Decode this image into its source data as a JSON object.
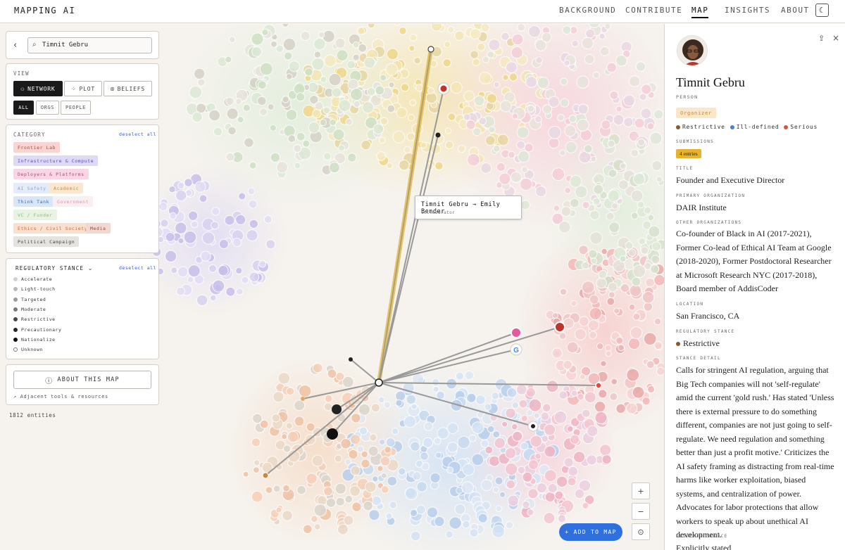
{
  "brand": "MAPPING AI",
  "nav": [
    "BACKGROUND",
    "CONTRIBUTE",
    "MAP",
    "INSIGHTS",
    "ABOUT"
  ],
  "nav_active": "MAP",
  "theme_icon": "☾",
  "search": {
    "value": "Timnit Gebru",
    "icon": "search-icon"
  },
  "view": {
    "label": "VIEW",
    "modes": [
      "NETWORK",
      "PLOT",
      "BELIEFS"
    ],
    "active_mode": "NETWORK",
    "filters": [
      "ALL",
      "ORGS",
      "PEOPLE"
    ],
    "active_filter": "ALL"
  },
  "category": {
    "label": "CATEGORY",
    "deselect": "deselect all",
    "items": [
      {
        "label": "Frontier Lab",
        "bg": "#fbd3d0",
        "fg": "#b2463c"
      },
      {
        "label": "Infrastructure & Compute",
        "bg": "#ded9f5",
        "fg": "#5a4cb0"
      },
      {
        "label": "Deployers & Platforms",
        "bg": "#f9d6e6",
        "fg": "#b3447a"
      },
      {
        "label": "AI Safety",
        "bg": "#e4ecfa",
        "fg": "#8aa4d8"
      },
      {
        "label": "Academic",
        "bg": "#fbe7cf",
        "fg": "#c98a3c"
      },
      {
        "label": "Think Tank",
        "bg": "#d8e6f7",
        "fg": "#3e6aa8"
      },
      {
        "label": "Government",
        "bg": "#fbeef0",
        "fg": "#d49ba8"
      },
      {
        "label": "VC / Funder",
        "bg": "#e8f3e3",
        "fg": "#8fb97e"
      },
      {
        "label": "Ethics / Civil Society",
        "bg": "#fbe0cf",
        "fg": "#c0693b"
      },
      {
        "label": "Media",
        "bg": "#f3d8d0",
        "fg": "#8a4b3b"
      },
      {
        "label": "Political Campaign",
        "bg": "#e4e3e0",
        "fg": "#444444"
      }
    ]
  },
  "stance": {
    "label": "REGULATORY STANCE",
    "deselect": "deselect all",
    "items": [
      {
        "label": "Accelerate",
        "color": "#d4d1cc"
      },
      {
        "label": "Light-touch",
        "color": "#bdb9b2"
      },
      {
        "label": "Targeted",
        "color": "#9e9a93"
      },
      {
        "label": "Moderate",
        "color": "#7c7871"
      },
      {
        "label": "Restrictive",
        "color": "#4a4640"
      },
      {
        "label": "Precautionary",
        "color": "#2a2724"
      },
      {
        "label": "Nationalize",
        "color": "#111111"
      },
      {
        "label": "Unknown",
        "color": "#ffffff"
      }
    ]
  },
  "about": {
    "button": "ABOUT THIS MAP",
    "adjacent": "↗ Adjacent tools & resources"
  },
  "entity_count": "1812 entities",
  "tooltip": {
    "title": "Timnit Gebru → Emily Bender",
    "subtitle": "Collaborator"
  },
  "zoom": {
    "in": "+",
    "out": "−",
    "reset": "⊙"
  },
  "add_button": "+ ADD TO MAP",
  "detail": {
    "name": "Timnit Gebru",
    "type": "PERSON",
    "role_badge": "Organizer",
    "tags": [
      {
        "label": "Restrictive",
        "color": "#8a5a2b"
      },
      {
        "label": "Ill-defined",
        "color": "#4a7fd6"
      },
      {
        "label": "Serious",
        "color": "#d2563a"
      }
    ],
    "submissions_label": "SUBMISSIONS",
    "submissions": "4 entries",
    "title_label": "TITLE",
    "title": "Founder and Executive Director",
    "primary_org_label": "PRIMARY ORGANIZATION",
    "primary_org": "DAIR Institute",
    "other_orgs_label": "OTHER ORGANIZATIONS",
    "other_orgs": "Co-founder of Black in AI (2017-2021), Former Co-lead of Ethical AI Team at Google (2018-2020), Former Postdoctoral Researcher at Microsoft Research NYC (2017-2018), Board member of AddisCoder",
    "location_label": "LOCATION",
    "location": "San Francisco, CA",
    "reg_stance_label": "REGULATORY STANCE",
    "reg_stance": "Restrictive",
    "stance_detail_label": "STANCE DETAIL",
    "stance_detail": "Calls for stringent AI regulation, arguing that Big Tech companies will not 'self-regulate' amid the current 'gold rush.' Has stated 'Unless there is external pressure to do something different, companies are not just going to self-regulate. We need regulation and something better than just a profit motive.' Criticizes the AI safety framing as distracting from real-time harms like worker exploitation, biased systems, and centralization of power. Advocates for labor protections that allow workers to speak up about unethical AI development.",
    "evidence_label": "EVIDENCE SOURCE",
    "evidence": "Explicitly stated"
  }
}
